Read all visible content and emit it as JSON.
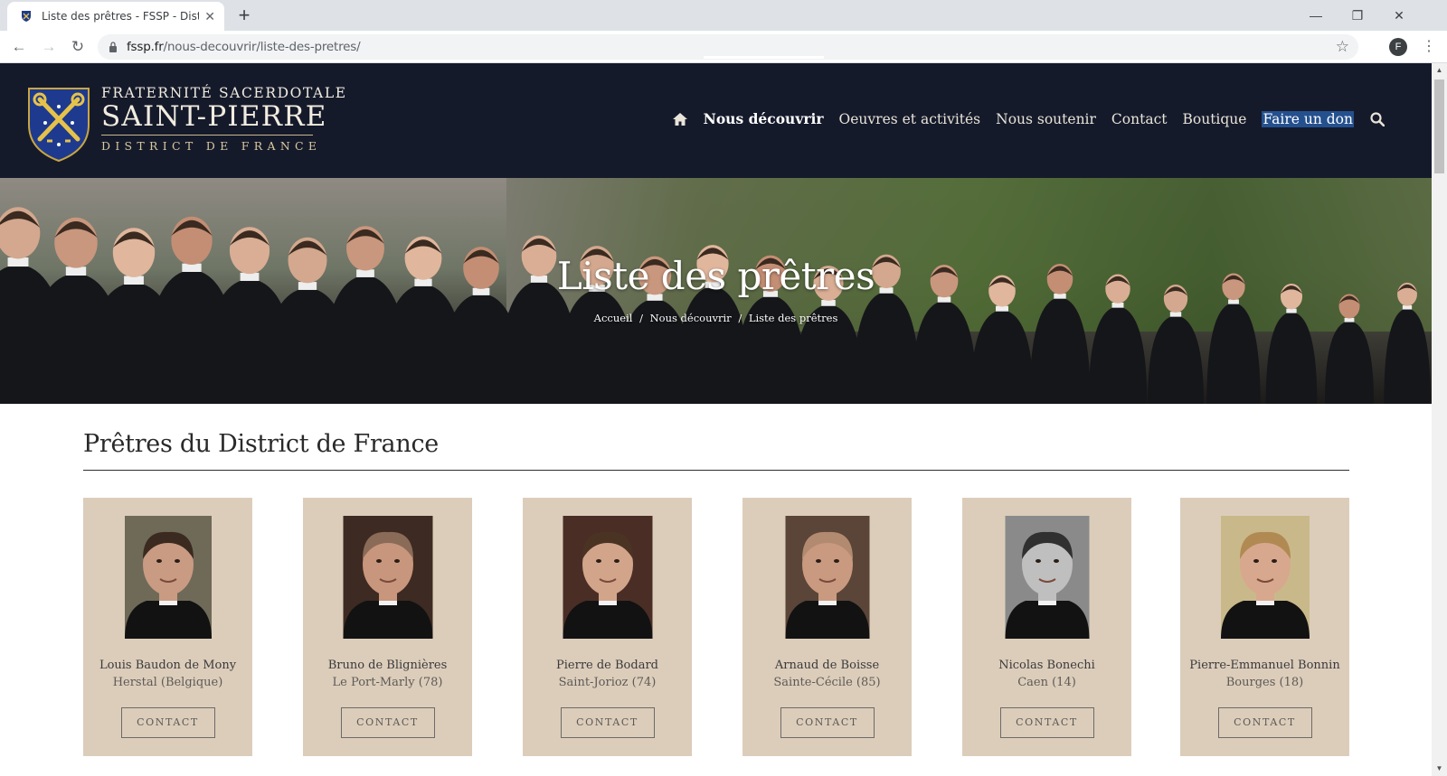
{
  "browser": {
    "tab_title": "Liste des prêtres - FSSP - District",
    "url_host": "fssp.fr",
    "url_path": "/nous-decouvrir/liste-des-pretres/",
    "profile_initial": "F"
  },
  "header": {
    "brand_line1": "FRATERNITÉ SACERDOTALE",
    "brand_line2": "SAINT-PIERRE",
    "brand_line3": "DISTRICT DE FRANCE",
    "nav": [
      {
        "label": "Nous découvrir"
      },
      {
        "label": "Oeuvres et activités"
      },
      {
        "label": "Nous soutenir"
      },
      {
        "label": "Contact"
      },
      {
        "label": "Boutique"
      },
      {
        "label": "Faire un don"
      }
    ]
  },
  "hero": {
    "title": "Liste des prêtres",
    "breadcrumb": [
      "Accueil",
      "Nous découvrir",
      "Liste des prêtres"
    ],
    "separator": "/"
  },
  "main": {
    "section_title": "Prêtres du District de France",
    "contact_label": "CONTACT",
    "priests": [
      {
        "name": "Louis Baudon de Mony",
        "place": "Herstal (Belgique)",
        "skin": "#c99b82",
        "hair": "#3a2a20",
        "bg": "#6f6a58"
      },
      {
        "name": "Bruno de Blignières",
        "place": "Le Port-Marly (78)",
        "skin": "#c7967c",
        "hair": "#8a6b58",
        "bg": "#3d2a22"
      },
      {
        "name": "Pierre de Bodard",
        "place": "Saint-Jorioz (74)",
        "skin": "#d2a58b",
        "hair": "#4b3324",
        "bg": "#4a2e26"
      },
      {
        "name": "Arnaud de Boisse",
        "place": "Sainte-Cécile (85)",
        "skin": "#c99a80",
        "hair": "#b28a70",
        "bg": "#5a4538"
      },
      {
        "name": "Nicolas Bonechi",
        "place": "Caen (14)",
        "skin": "#bfbfbf",
        "hair": "#303030",
        "bg": "#8a8a8a"
      },
      {
        "name": "Pierre-Emmanuel Bonnin",
        "place": "Bourges (18)",
        "skin": "#d8a88e",
        "hair": "#b08a52",
        "bg": "#c9b98a"
      }
    ]
  }
}
